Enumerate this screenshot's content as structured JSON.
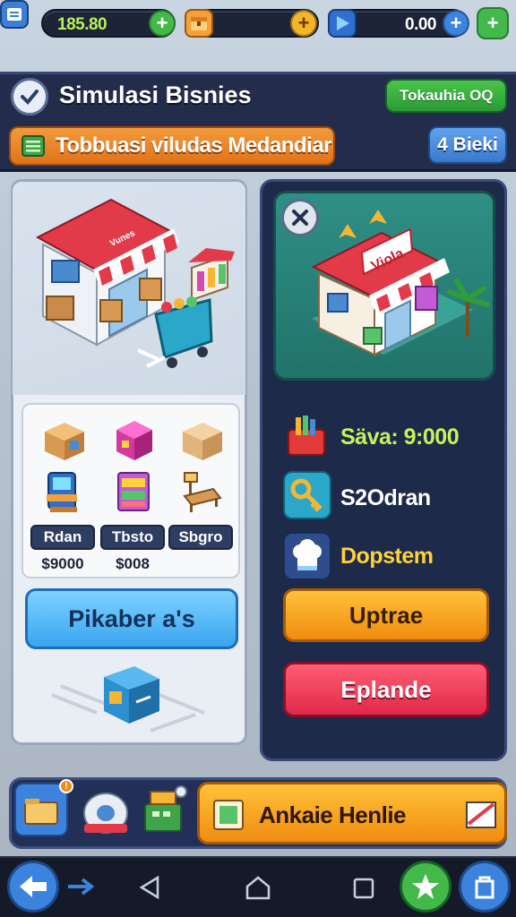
{
  "currency": {
    "cash": "185.80",
    "gems": "0.00",
    "add_label": "+"
  },
  "header": {
    "title": "Simulasi Bisnies",
    "green_button": "Tokauhia OQ",
    "banner_text": "Tobbuasi viludas Medandiar",
    "blue_button": "4 Bieki"
  },
  "shop_items": [
    {
      "name": "Rdan",
      "price": "$9000"
    },
    {
      "name": "Tbsto",
      "price": "$008"
    },
    {
      "name": "Sbgro",
      "price": ""
    }
  ],
  "left_button": "Pikaber a's",
  "store_sign": "Viola",
  "stats": [
    {
      "text": "Säva: 9:000",
      "color": "#c9f25a"
    },
    {
      "text": "S2Odran",
      "color": "#ffffff"
    },
    {
      "text": "Dopstem",
      "color": "#ffd23a"
    }
  ],
  "buttons": {
    "upgrade": "Uptrae",
    "expand": "Eplande"
  },
  "action_bar": {
    "main_label": "Ankaie Henlie"
  },
  "colors": {
    "accent_orange": "#f08c0f",
    "accent_red": "#e0284a",
    "panel_navy": "#1e2a4a",
    "cash_green": "#b8f05a"
  }
}
